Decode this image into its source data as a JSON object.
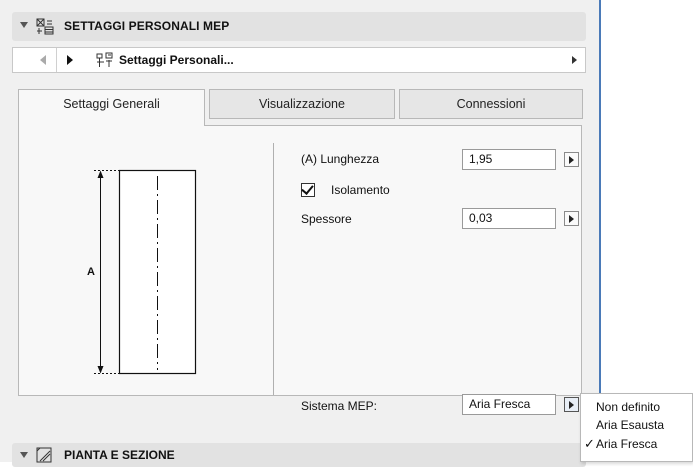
{
  "header": {
    "title": "SETTAGGI PERSONALI MEP"
  },
  "nav": {
    "label": "Settaggi Personali..."
  },
  "tabs": [
    {
      "label": "Settaggi Generali",
      "active": true
    },
    {
      "label": "Visualizzazione",
      "active": false
    },
    {
      "label": "Connessioni",
      "active": false
    }
  ],
  "preview": {
    "dimension_label": "A"
  },
  "params": {
    "length_label": "(A) Lunghezza",
    "length_value": "1,95",
    "insulation_label": "Isolamento",
    "insulation_checked": true,
    "thickness_label": "Spessore",
    "thickness_value": "0,03",
    "system_label": "Sistema MEP:",
    "system_value": "Aria Fresca"
  },
  "menu": {
    "items": [
      {
        "label": "Non definito",
        "checked": false
      },
      {
        "label": "Aria Esausta",
        "checked": false
      },
      {
        "label": "Aria Fresca",
        "checked": true
      }
    ],
    "check_glyph": "✓"
  },
  "footer": {
    "title": "PIANTA E SEZIONE"
  },
  "colors": {
    "accent_border": "#4a7ab8",
    "panel_bg": "#f0f0f0"
  }
}
